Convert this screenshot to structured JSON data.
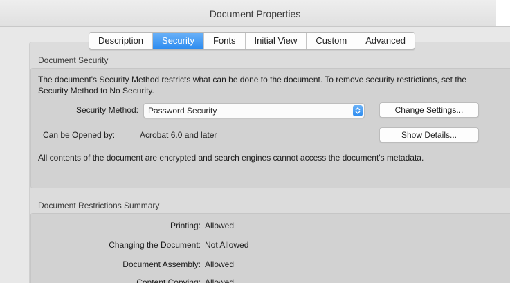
{
  "window": {
    "title": "Document Properties"
  },
  "tabs": [
    {
      "label": "Description",
      "active": false
    },
    {
      "label": "Security",
      "active": true
    },
    {
      "label": "Fonts",
      "active": false
    },
    {
      "label": "Initial View",
      "active": false
    },
    {
      "label": "Custom",
      "active": false
    },
    {
      "label": "Advanced",
      "active": false
    }
  ],
  "security": {
    "section_title": "Document Security",
    "description": "The document's Security Method restricts what can be done to the document. To remove security restrictions, set the Security Method to No Security.",
    "method_label": "Security Method:",
    "method_value": "Password Security",
    "change_settings_button": "Change Settings...",
    "opened_by_label": "Can be Opened by:",
    "opened_by_value": "Acrobat 6.0 and later",
    "show_details_button": "Show Details...",
    "encryption_note": "All contents of the document are encrypted and search engines cannot access the document's metadata."
  },
  "restrictions": {
    "section_title": "Document Restrictions Summary",
    "items": [
      {
        "label": "Printing:",
        "value": "Allowed"
      },
      {
        "label": "Changing the Document:",
        "value": "Not Allowed"
      },
      {
        "label": "Document Assembly:",
        "value": "Allowed"
      },
      {
        "label": "Content Copying:",
        "value": "Allowed"
      }
    ]
  },
  "colors": {
    "accent": "#2d8cf0",
    "panel": "#dcdcdc"
  }
}
